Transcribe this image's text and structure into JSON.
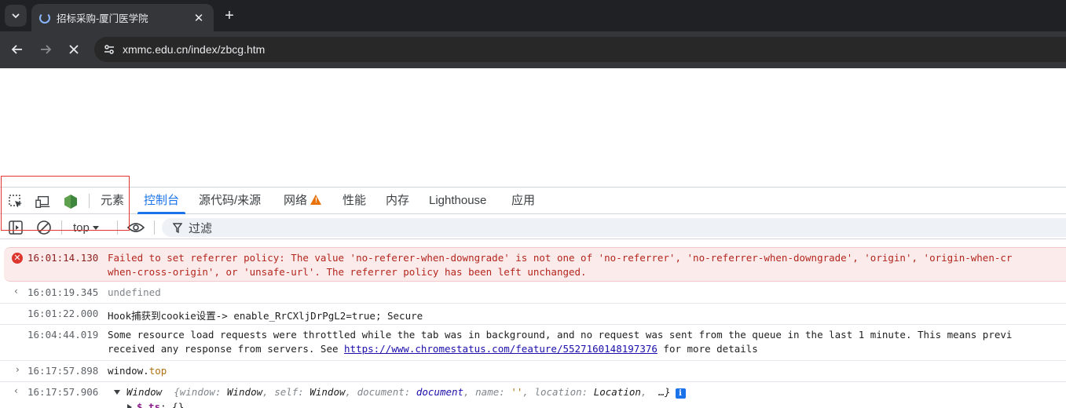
{
  "browser": {
    "tab": {
      "title": "招标采购-厦门医学院",
      "close": "✕"
    },
    "new_tab": "+",
    "url": "xmmc.edu.cn/index/zbcg.htm"
  },
  "devtools": {
    "tabs": [
      {
        "label": "元素"
      },
      {
        "label": "控制台"
      },
      {
        "label": "源代码/来源"
      },
      {
        "label": "网络"
      },
      {
        "label": "性能"
      },
      {
        "label": "内存"
      },
      {
        "label": "Lighthouse"
      },
      {
        "label": "应用"
      }
    ],
    "active_tab": "控制台",
    "network_warning": "!",
    "context": "top",
    "filter_placeholder": "过滤"
  },
  "console": {
    "messages": [
      {
        "level": "error",
        "time": "16:01:14.130",
        "line1": "Failed to set referrer policy: The value 'no-referer-when-downgrade' is not one of 'no-referrer', 'no-referrer-when-downgrade', 'origin', 'origin-when-cross-origin', 'same-origin', 'strict-origin', 'strict-origin-when-cross-origin', 'unsafe-url'.",
        "line1_visible": "Failed to set referrer policy: The value 'no-referer-when-downgrade' is not one of 'no-referrer', 'no-referrer-when-downgrade', 'origin', 'origin-when-cr",
        "line2": "when-cross-origin', or 'unsafe-url'. The referrer policy has been left unchanged."
      },
      {
        "level": "result",
        "time": "16:01:19.345",
        "text": "undefined"
      },
      {
        "level": "log",
        "time": "16:01:22.000",
        "text": "Hook捕获到cookie设置-> enable_RrCXljDrPgL2=true; Secure"
      },
      {
        "level": "log",
        "time": "16:04:44.019",
        "line1": "Some resource load requests were throttled while the tab was in background, and no request was sent from the queue in the last 1 minute. This means previ",
        "line2_prefix": "received any response from servers. See ",
        "link": "https://www.chromestatus.com/feature/5527160148197376",
        "line2_suffix": " for more details"
      },
      {
        "level": "input",
        "time": "16:17:57.898",
        "obj": "window.",
        "prop": "top"
      },
      {
        "level": "result",
        "time": "16:17:57.906",
        "label": "Window",
        "preview": [
          {
            "k": "window",
            "v": "Window"
          },
          {
            "k": "self",
            "v": "Window"
          },
          {
            "k": "document",
            "v": "document"
          },
          {
            "k": "name",
            "v": "''"
          },
          {
            "k": "location",
            "v": "Location"
          }
        ],
        "ellipsis": "…}",
        "open_brace": "{",
        "info": "i",
        "child": {
          "name": "$_ts",
          "value": "{}"
        }
      }
    ]
  }
}
